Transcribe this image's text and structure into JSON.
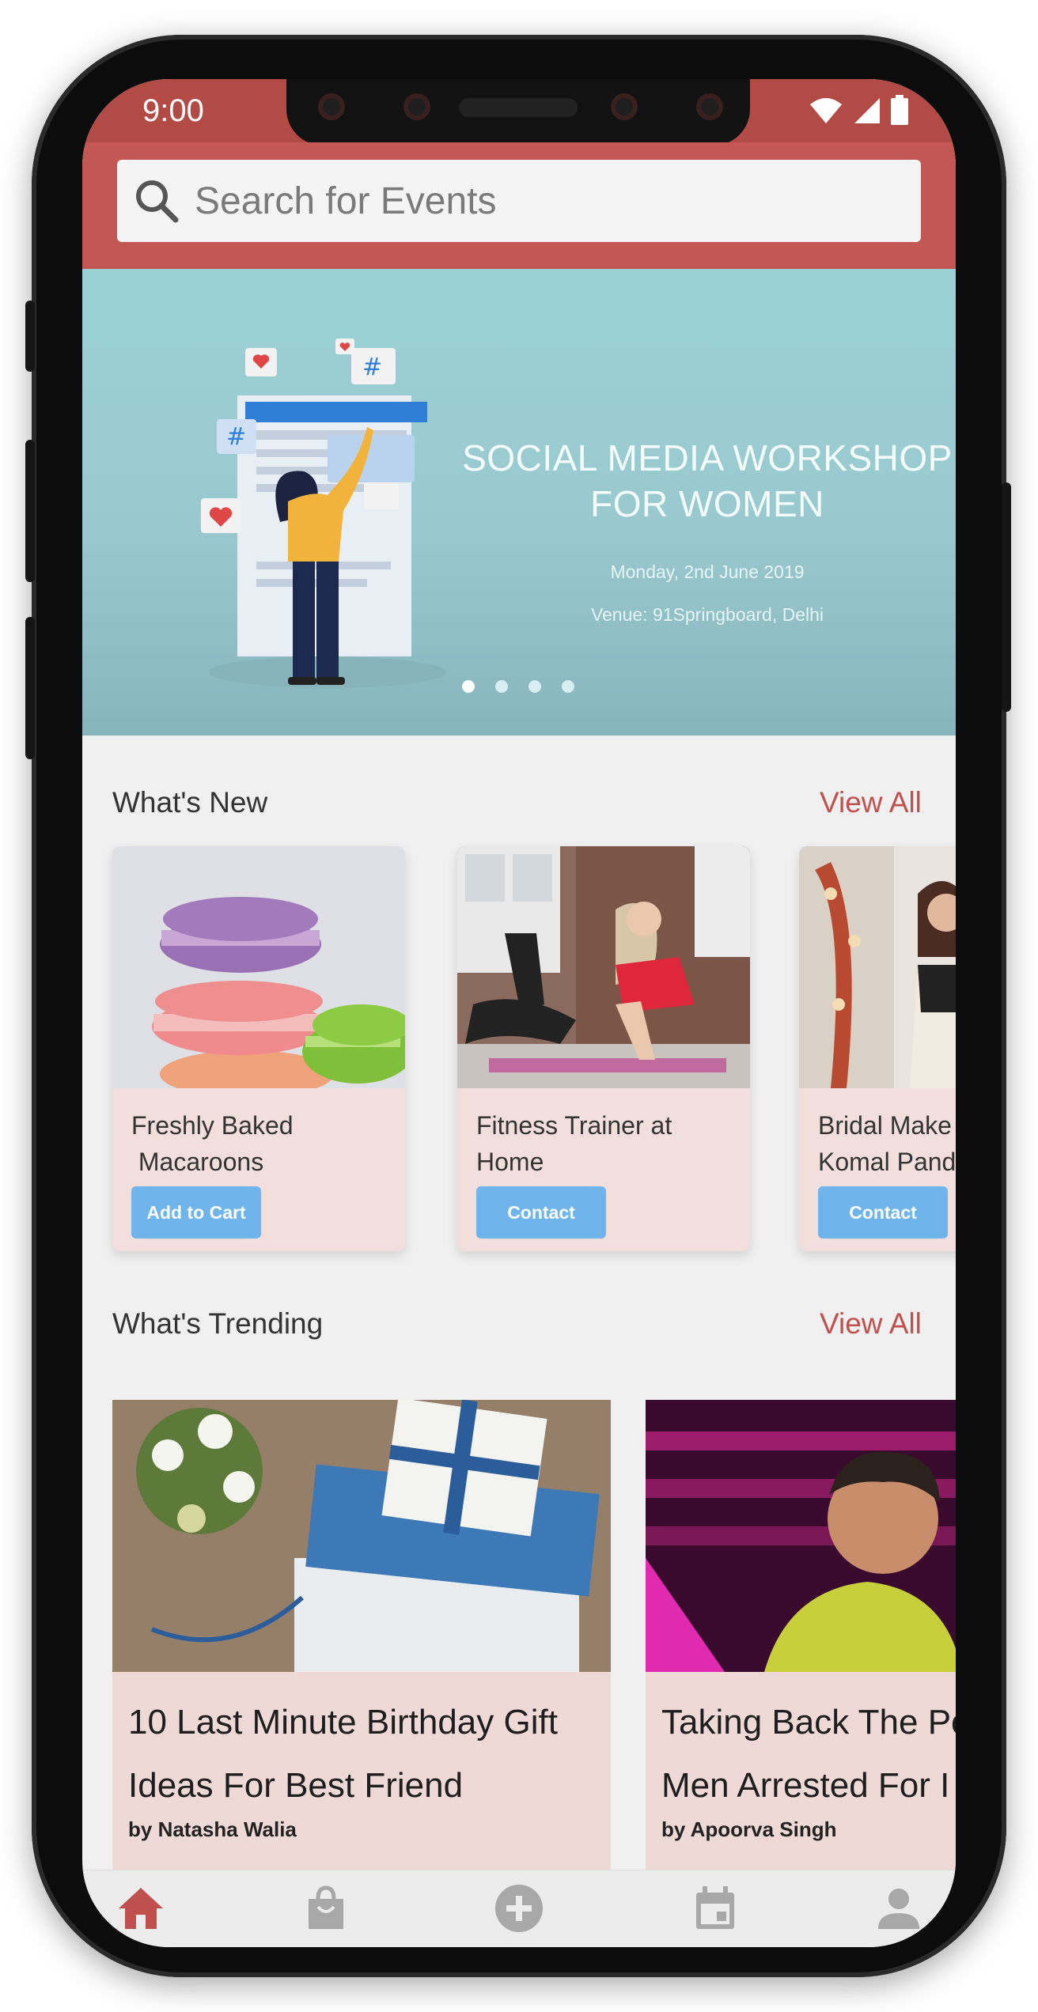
{
  "status_bar": {
    "time": "9:00"
  },
  "search": {
    "placeholder": "Search for Events"
  },
  "banner": {
    "title_line1": "SOCIAL MEDIA WORKSHOP",
    "title_line2": "FOR WOMEN",
    "date": "Monday, 2nd June 2019",
    "venue": "Venue: 91Springboard, Delhi",
    "active_slide": 1,
    "slide_count": 4
  },
  "whats_new": {
    "title": "What's New",
    "view_all": "View All",
    "cards": [
      {
        "title_line1": "Freshly Baked",
        "title_line2": " Macaroons",
        "button": "Add to Cart",
        "image": "macarons-photo"
      },
      {
        "title_line1": "Fitness Trainer at",
        "title_line2": "Home",
        "button": "Contact",
        "image": "fitness-photo"
      },
      {
        "title_line1": "Bridal Make",
        "title_line2": "Komal Pand",
        "button": "Contact",
        "image": "bridal-photo"
      }
    ]
  },
  "whats_trending": {
    "title": "What's Trending",
    "view_all": "View All",
    "cards": [
      {
        "title_line1": "10 Last Minute Birthday Gift",
        "title_line2": "Ideas For Best Friend",
        "author": "by Natasha Walia",
        "image": "gifts-photo"
      },
      {
        "title_line1": "Taking Back The Po",
        "title_line2": "Men Arrested For I",
        "author": "by Apoorva Singh",
        "image": "speaker-photo"
      }
    ]
  },
  "bottom_nav": {
    "items": [
      {
        "icon": "home-icon",
        "active": true
      },
      {
        "icon": "shopping-bag-icon",
        "active": false
      },
      {
        "icon": "add-circle-icon",
        "active": false
      },
      {
        "icon": "calendar-icon",
        "active": false
      },
      {
        "icon": "profile-icon",
        "active": false
      }
    ]
  },
  "colors": {
    "header": "#c25754",
    "status_bar": "#b24a46",
    "accent": "#c0504d",
    "button": "#6fb5eb",
    "card_bg": "#f2dedd",
    "banner": "#9bd1d6",
    "nav_active": "#c0504d",
    "nav_inactive": "#a8a8a8"
  }
}
